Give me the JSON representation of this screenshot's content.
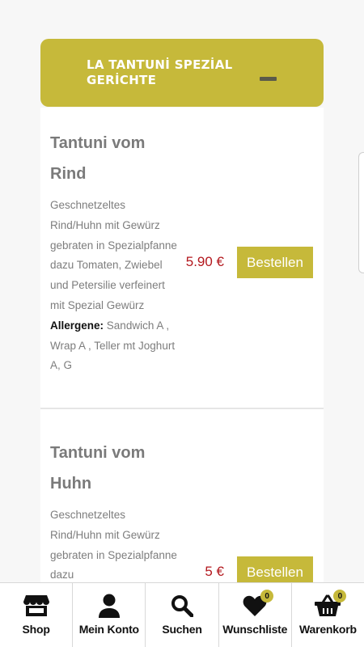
{
  "category": {
    "title": "LA TANTUNİ SPEZİAL GERİCHTE"
  },
  "items": [
    {
      "title": "Tantuni vom Rind",
      "description": "Geschnetzeltes Rind/Huhn mit Gewürz gebraten in Spezialpfanne dazu Tomaten, Zwiebel und Petersilie verfeinert mit Spezial Gewürz",
      "allergens_label": "Allergene:",
      "allergens": "Sandwich A , Wrap A , Teller mt Joghurt A, G",
      "price": "5.90 €",
      "order_label": "Bestellen"
    },
    {
      "title": "Tantuni vom Huhn",
      "description": "Geschnetzeltes Rind/Huhn mit Gewürz gebraten in Spezialpfanne dazu",
      "price": "5 €",
      "order_label": "Bestellen"
    }
  ],
  "nav": {
    "shop": "Shop",
    "account": "Mein Konto",
    "search": "Suchen",
    "wishlist": "Wunschliste",
    "wishlist_count": "0",
    "cart": "Warenkorb",
    "cart_count": "0"
  },
  "colors": {
    "accent": "#c6b93a",
    "price": "#b3171d"
  }
}
